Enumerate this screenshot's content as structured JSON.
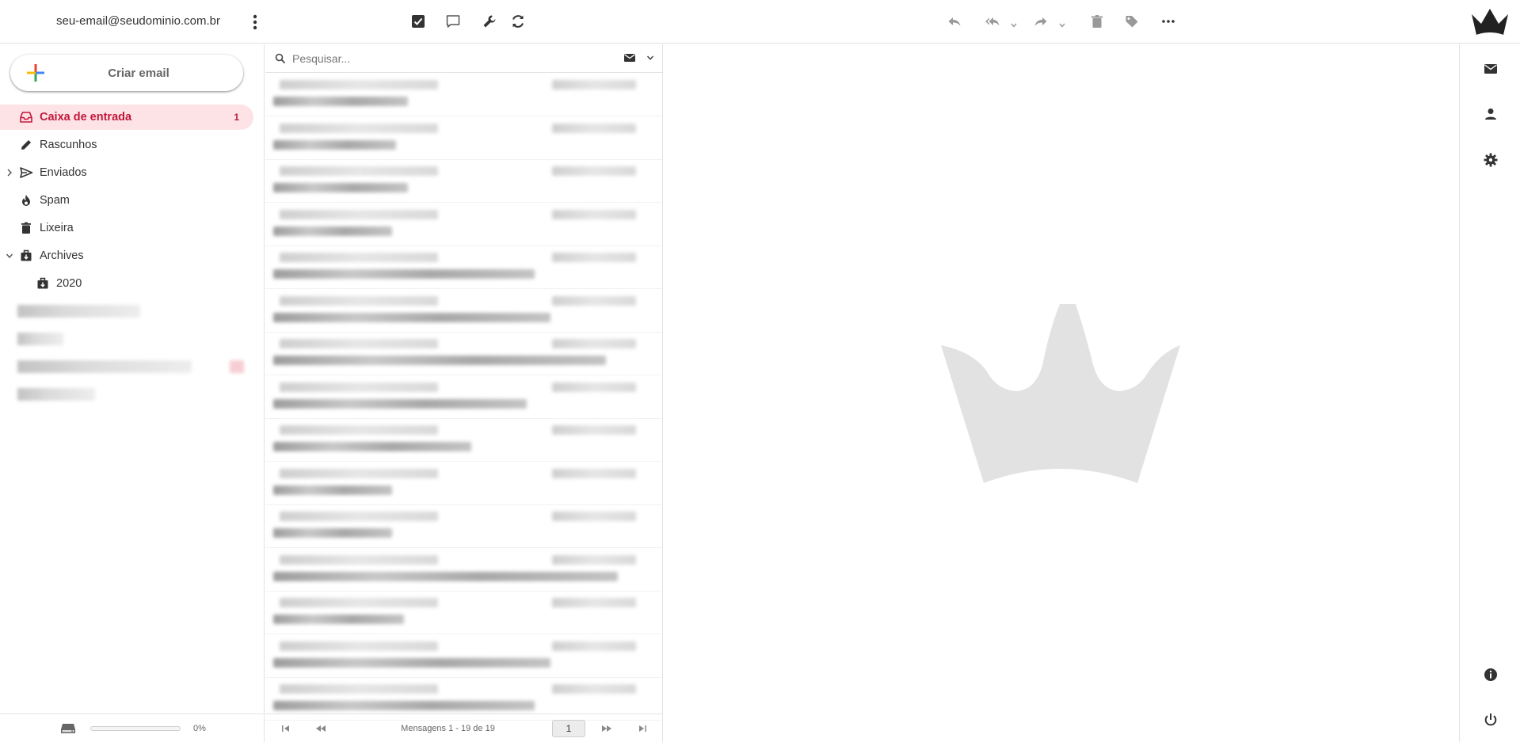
{
  "account": {
    "email": "seu-email@seudominio.com.br"
  },
  "toolbar": {
    "left_icons": [
      "select-icon",
      "thread-icon",
      "options-icon",
      "refresh-icon"
    ],
    "right_icons": [
      "reply-icon",
      "reply-all-icon",
      "forward-icon",
      "delete-icon",
      "tag-icon",
      "more-icon"
    ]
  },
  "compose": {
    "label": "Criar email"
  },
  "folders": [
    {
      "label": "Caixa de entrada",
      "count": "1",
      "icon": "inbox-icon",
      "active": true
    },
    {
      "label": "Rascunhos",
      "icon": "pencil-icon"
    },
    {
      "label": "Enviados",
      "icon": "send-icon"
    },
    {
      "label": "Spam",
      "icon": "fire-icon"
    },
    {
      "label": "Lixeira",
      "icon": "trash-icon"
    },
    {
      "label": "Archives",
      "icon": "archive-icon"
    },
    {
      "label": "2020",
      "icon": "archive-icon"
    }
  ],
  "quota": {
    "percent_label": "0%",
    "fraction": 0.0
  },
  "search": {
    "placeholder": "Pesquisar..."
  },
  "pager": {
    "count_label": "Mensagens 1 - 19 de 19",
    "page": "1"
  },
  "colors": {
    "accent": "#c2183a",
    "active_bg": "#fde3e6"
  }
}
